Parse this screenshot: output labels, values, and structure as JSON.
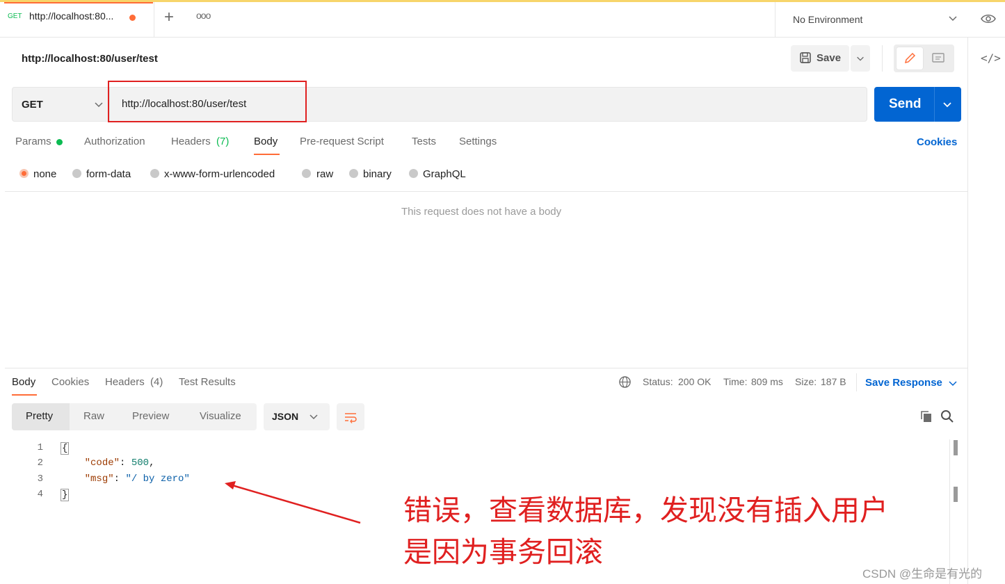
{
  "tab": {
    "method": "GET",
    "title": "http://localhost:80..."
  },
  "environment": {
    "label": "No Environment"
  },
  "request": {
    "title": "http://localhost:80/user/test",
    "method": "GET",
    "url": "http://localhost:80/user/test",
    "save_label": "Save",
    "send_label": "Send"
  },
  "request_tabs": {
    "params": "Params",
    "authorization": "Authorization",
    "headers": "Headers",
    "headers_count": "(7)",
    "body": "Body",
    "prerequest": "Pre-request Script",
    "tests": "Tests",
    "settings": "Settings",
    "cookies": "Cookies"
  },
  "body_types": [
    "none",
    "form-data",
    "x-www-form-urlencoded",
    "raw",
    "binary",
    "GraphQL"
  ],
  "body_empty_message": "This request does not have a body",
  "response": {
    "tabs": {
      "body": "Body",
      "cookies": "Cookies",
      "headers": "Headers",
      "headers_count": "(4)",
      "test_results": "Test Results"
    },
    "status_label": "Status:",
    "status_value": "200 OK",
    "time_label": "Time:",
    "time_value": "809 ms",
    "size_label": "Size:",
    "size_value": "187 B",
    "save_response": "Save Response",
    "views": {
      "pretty": "Pretty",
      "raw": "Raw",
      "preview": "Preview",
      "visualize": "Visualize"
    },
    "format": "JSON",
    "lines": [
      "1",
      "2",
      "3",
      "4"
    ],
    "code": {
      "open": "{",
      "code_key": "\"code\"",
      "code_val": "500",
      "msg_key": "\"msg\"",
      "msg_val": "\"/ by zero\"",
      "close": "}"
    }
  },
  "annotation": {
    "line1": "错误，查看数据库，发现没有插入用户",
    "line2": "是因为事务回滚"
  },
  "watermark": "CSDN @生命是有光的",
  "colors": {
    "accent": "#ff6c37",
    "send": "#0265d2",
    "annotation": "#e02020"
  }
}
